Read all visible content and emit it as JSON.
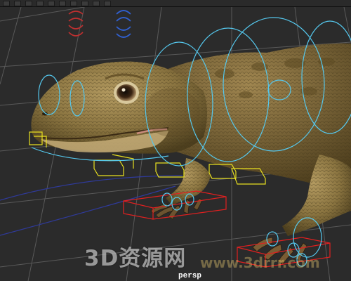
{
  "viewport": {
    "camera_label": "persp"
  },
  "toolbar": {
    "button_count": 10
  },
  "watermark": {
    "text": "3D资源网",
    "url": "www.3drrr.com"
  },
  "controls": {
    "curve_color": "#55c8ee",
    "ik_handle_color": "#e8e020",
    "foot_control_color": "#e02020",
    "selection_color": "#c03030",
    "selected_color": "#3060d0",
    "grid_color": "#6a6a6a"
  }
}
